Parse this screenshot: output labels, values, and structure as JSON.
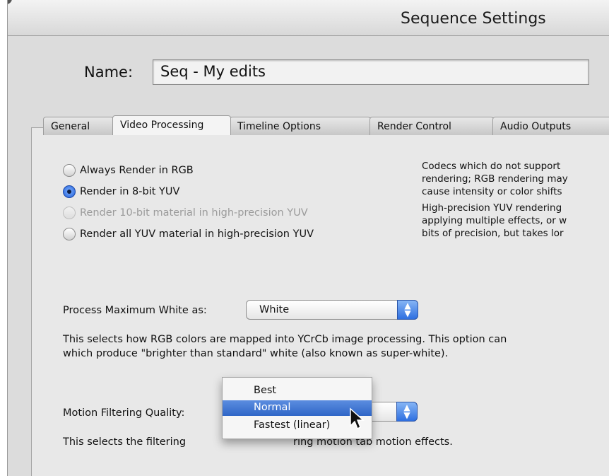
{
  "window": {
    "title": "Sequence Settings"
  },
  "name_field": {
    "label": "Name:",
    "value": "Seq - My edits"
  },
  "tabs": [
    {
      "label": "General",
      "active": false
    },
    {
      "label": "Video Processing",
      "active": true
    },
    {
      "label": "Timeline Options",
      "active": false
    },
    {
      "label": "Render Control",
      "active": false
    },
    {
      "label": "Audio Outputs",
      "active": false
    }
  ],
  "render_options": [
    {
      "label": "Always Render in RGB",
      "selected": false,
      "enabled": true
    },
    {
      "label": "Render in 8-bit YUV",
      "selected": true,
      "enabled": true
    },
    {
      "label": "Render 10-bit material in high-precision YUV",
      "selected": false,
      "enabled": false
    },
    {
      "label": "Render all YUV material in high-precision YUV",
      "selected": false,
      "enabled": true
    }
  ],
  "description": {
    "lines1": [
      "Codecs which do not support",
      "rendering; RGB rendering may",
      "cause intensity or color shifts"
    ],
    "lines2": [
      "High-precision YUV rendering",
      "applying multiple effects, or w",
      "bits of precision, but takes lor"
    ]
  },
  "max_white": {
    "label": "Process Maximum White as:",
    "value": "White",
    "help_lines": [
      "This selects how RGB colors are mapped into YCrCb image processing. This option can",
      "which produce \"brighter than standard\" white (also known as super-white)."
    ]
  },
  "motion_filtering": {
    "label": "Motion Filtering Quality:",
    "help_visible": "This selects the filtering",
    "help_tail": "ring motion tab motion effects.",
    "menu_options": [
      "Best",
      "Normal",
      "Fastest (linear)"
    ],
    "selected": "Normal"
  },
  "icons": {
    "stepper": "up-down-arrows-icon",
    "cursor": "mouse-pointer-icon"
  },
  "colors": {
    "accent": "#2f66c7",
    "window_bg": "#dcdcdc",
    "panel_bg": "#e8e8e8"
  }
}
